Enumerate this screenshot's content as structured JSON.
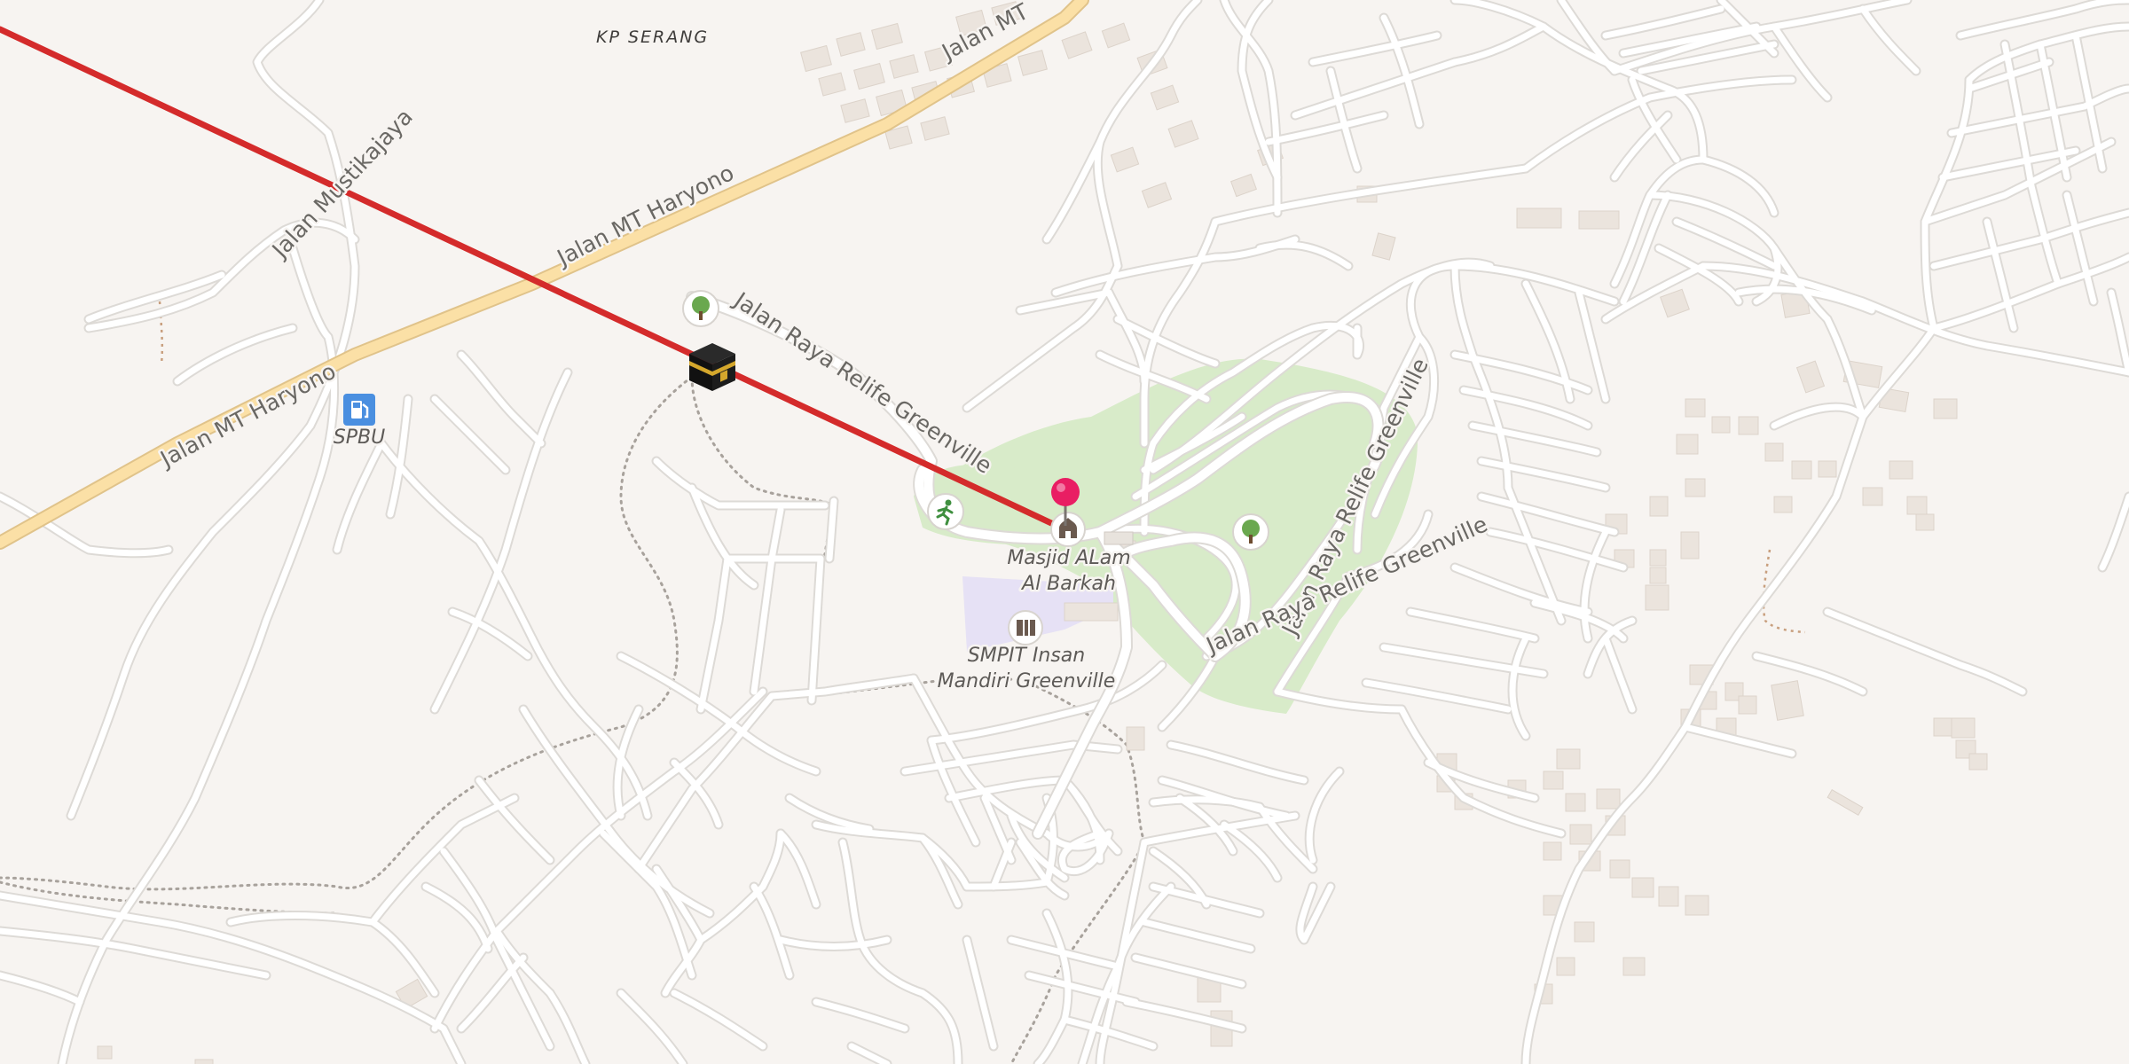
{
  "map": {
    "colors": {
      "background": "#f7f4f1",
      "major_road": "#fbe0a6",
      "park": "#d8ebc9",
      "school_area": "#e6e1f5",
      "qibla_line": "#d42b2b",
      "pin": "#e91e63",
      "fuel_icon": "#4a8fe0"
    },
    "place_labels": {
      "kp_serang": "KP SERANG"
    },
    "road_labels": {
      "mt_haryono_top": "Jalan MT",
      "mt_haryono_mid": "Jalan MT Haryono",
      "mt_haryono_low": "Jalan MT Haryono",
      "mustikajaya": "Jalan Mustikajaya",
      "relife_north": "Jalan Raya Relife Greenville",
      "relife_east": "Jalan Raya Relife Greenville",
      "relife_south": "Jalan Raya Relife Greenville"
    },
    "poi_labels": {
      "fuel": "SPBU",
      "mosque_line1": "Masjid ALam",
      "mosque_line2": "Al Barkah",
      "school_line1": "SMPIT Insan",
      "school_line2": "Mandiri Greenville"
    },
    "icons": {
      "kaaba": "kaaba-icon",
      "pin": "location-pin-icon",
      "mosque": "mosque-icon",
      "school": "school-icon",
      "fuel": "fuel-station-icon",
      "park": "tree-icon",
      "sport": "running-icon"
    }
  }
}
